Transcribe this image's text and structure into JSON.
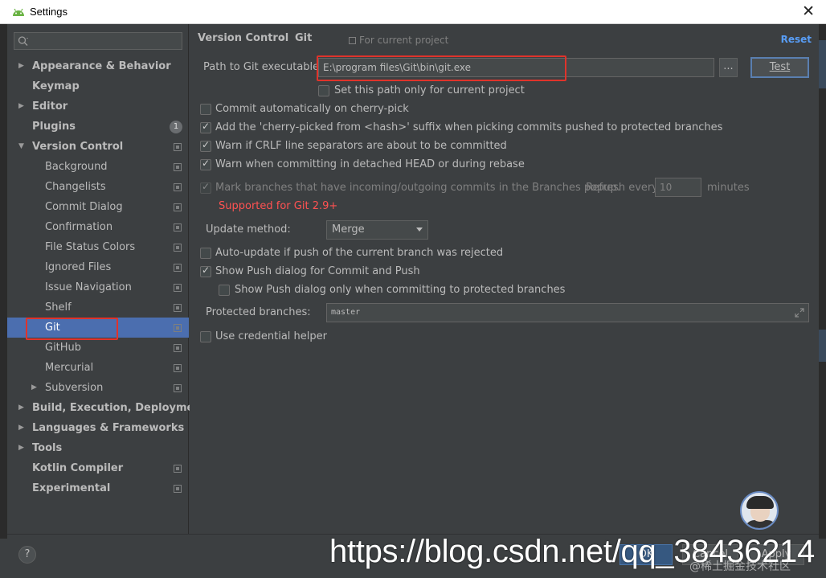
{
  "window": {
    "title": "Settings",
    "close_glyph": "✕",
    "app_icon": "android-icon"
  },
  "sidebar": {
    "search_placeholder": "",
    "items": [
      {
        "label": "Appearance & Behavior",
        "bold": true,
        "arrow": "right"
      },
      {
        "label": "Keymap",
        "bold": true
      },
      {
        "label": "Editor",
        "bold": true,
        "arrow": "right"
      },
      {
        "label": "Plugins",
        "bold": true,
        "badge": "1"
      },
      {
        "label": "Version Control",
        "bold": true,
        "arrow": "down"
      },
      {
        "label": "Background"
      },
      {
        "label": "Changelists"
      },
      {
        "label": "Commit Dialog"
      },
      {
        "label": "Confirmation"
      },
      {
        "label": "File Status Colors"
      },
      {
        "label": "Ignored Files"
      },
      {
        "label": "Issue Navigation"
      },
      {
        "label": "Shelf"
      },
      {
        "label": "Git",
        "selected": true
      },
      {
        "label": "GitHub"
      },
      {
        "label": "Mercurial"
      },
      {
        "label": "Subversion",
        "arrow": "right"
      },
      {
        "label": "Build, Execution, Deployment",
        "bold": true,
        "arrow": "right"
      },
      {
        "label": "Languages & Frameworks",
        "bold": true,
        "arrow": "right"
      },
      {
        "label": "Tools",
        "bold": true,
        "arrow": "right"
      },
      {
        "label": "Kotlin Compiler",
        "bold": true
      },
      {
        "label": "Experimental",
        "bold": true
      }
    ]
  },
  "header": {
    "breadcrumb_parent": "Version Control",
    "breadcrumb_sep": "›",
    "breadcrumb_current": "Git",
    "scope": "For current project",
    "reset": "Reset"
  },
  "git": {
    "path_label": "Path to Git executable:",
    "path_value": "E:\\program files\\Git\\bin\\git.exe",
    "browse": "...",
    "test": "Test",
    "set_path_current": "Set this path only for current project",
    "commit_auto_cherry": "Commit automatically on cherry-pick",
    "add_cherry_suffix": "Add the 'cherry-picked from <hash>' suffix when picking commits pushed to protected branches",
    "warn_crlf": "Warn if CRLF line separators are about to be committed",
    "warn_detached": "Warn when committing in detached HEAD or during rebase",
    "mark_branches": "Mark branches that have incoming/outgoing commits in the Branches popup.",
    "refresh_every": "Refresh every",
    "refresh_value": "10",
    "minutes": "minutes",
    "supported_note": "Supported for Git 2.9+",
    "update_method_label": "Update method:",
    "update_method_value": "Merge",
    "auto_update": "Auto-update if push of the current branch was rejected",
    "show_push_dialog": "Show Push dialog for Commit and Push",
    "show_push_protected": "Show Push dialog only when committing to protected branches",
    "protected_label": "Protected branches:",
    "protected_value": "master",
    "credential_helper": "Use credential helper"
  },
  "footer": {
    "help": "?",
    "ok": "OK",
    "cancel": "Cancel",
    "apply": "Apply"
  },
  "watermark": {
    "url": "https://blog.csdn.net/qq_38436214",
    "sub": "@稀土掘金技术社区"
  },
  "colors": {
    "accent": "#4b6eaf",
    "link": "#589df6",
    "warning": "#ff5252",
    "highlight_box": "#e0332b"
  }
}
